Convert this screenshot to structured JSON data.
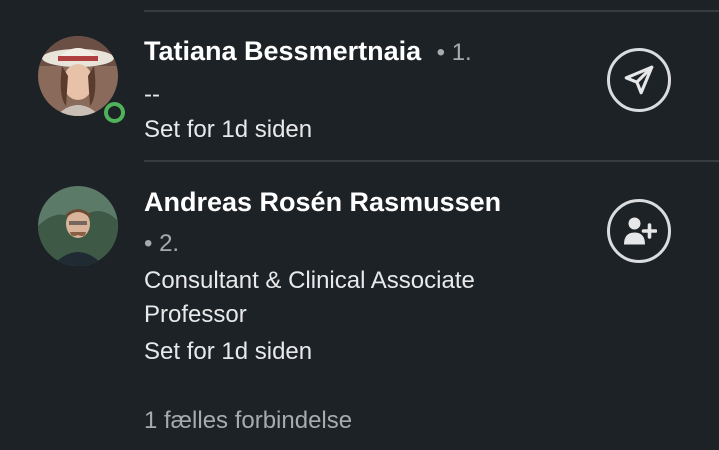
{
  "connections": [
    {
      "name": "Tatiana Bessmertnaia",
      "degree": "• 1.",
      "headline": "--",
      "seen": "Set for 1d siden",
      "online": true,
      "action_icon": "send-message-icon"
    },
    {
      "name": "Andreas Rosén Rasmussen",
      "degree": "• 2.",
      "headline_line1": "Consultant & Clinical Associate",
      "headline_line2": "Professor",
      "seen": "Set for 1d siden",
      "mutual": "1 fælles forbindelse",
      "online": false,
      "action_icon": "connect-add-person-icon"
    }
  ],
  "colors": {
    "background": "#1d2226",
    "online": "#4fb35a",
    "muted_text": "#a8abae"
  }
}
